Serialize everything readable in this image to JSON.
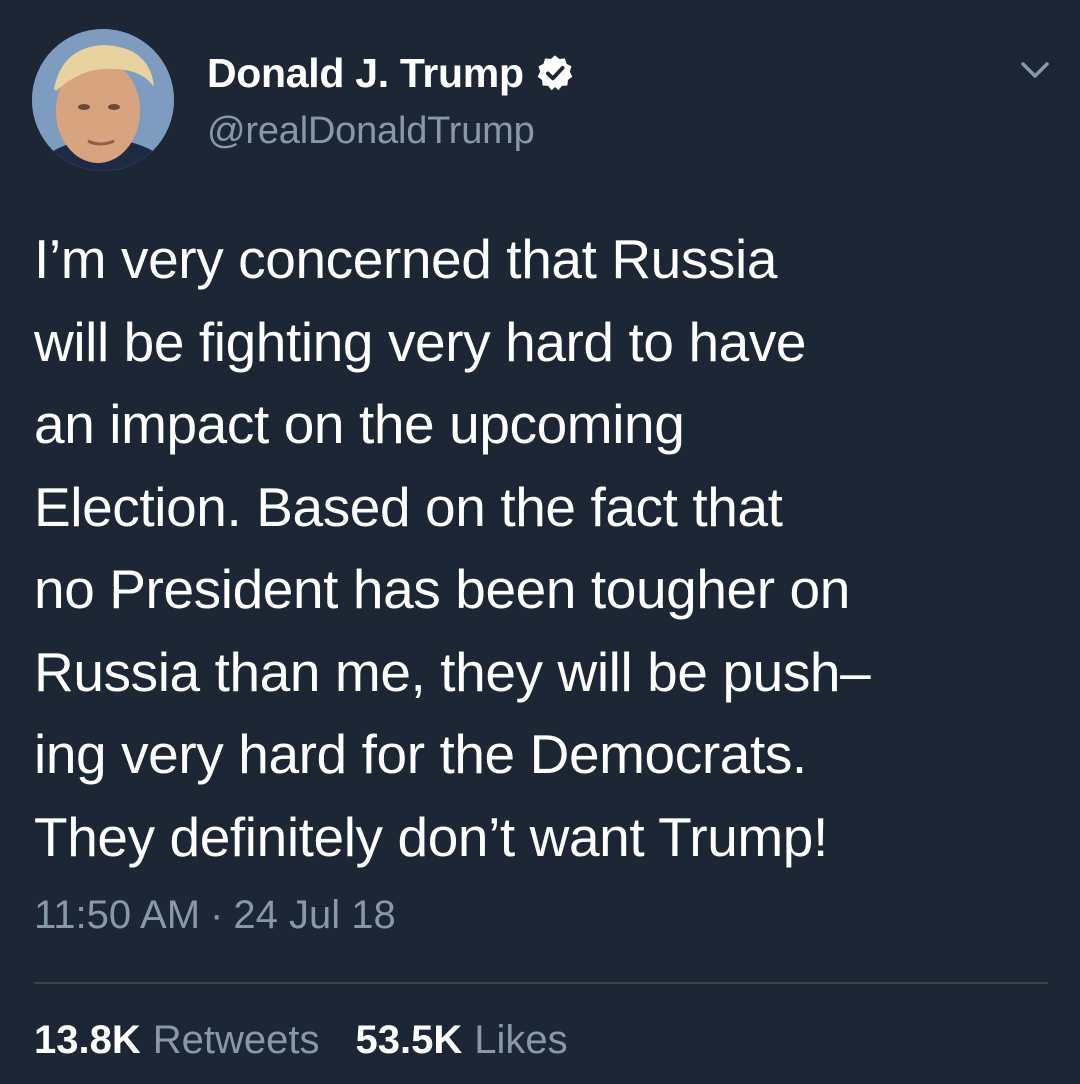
{
  "author": {
    "display_name": "Donald J. Trump",
    "handle": "@realDonaldTrump",
    "verified": true
  },
  "tweet": {
    "lines": [
      "I’m very concerned that Russia",
      "will be fighting very hard to have",
      "an impact on the upcoming",
      "Election. Based on the fact that",
      "no President has been tougher on",
      "Russia than me, they will be push–",
      "ing very hard for the Democrats.",
      "They definitely don’t want Trump!"
    ],
    "time": "11:50 AM",
    "separator": "·",
    "date": "24 Jul 18"
  },
  "stats": {
    "retweets_count": "13.8K",
    "retweets_label": "Retweets",
    "likes_count": "53.5K",
    "likes_label": "Likes"
  },
  "colors": {
    "background": "#1c2634",
    "primary_text": "#ffffff",
    "secondary_text": "#8899a6",
    "divider": "#38444d",
    "verified_badge": "#ffffff"
  },
  "icons": {
    "verified": "verified-badge-icon",
    "menu": "chevron-down-icon"
  }
}
